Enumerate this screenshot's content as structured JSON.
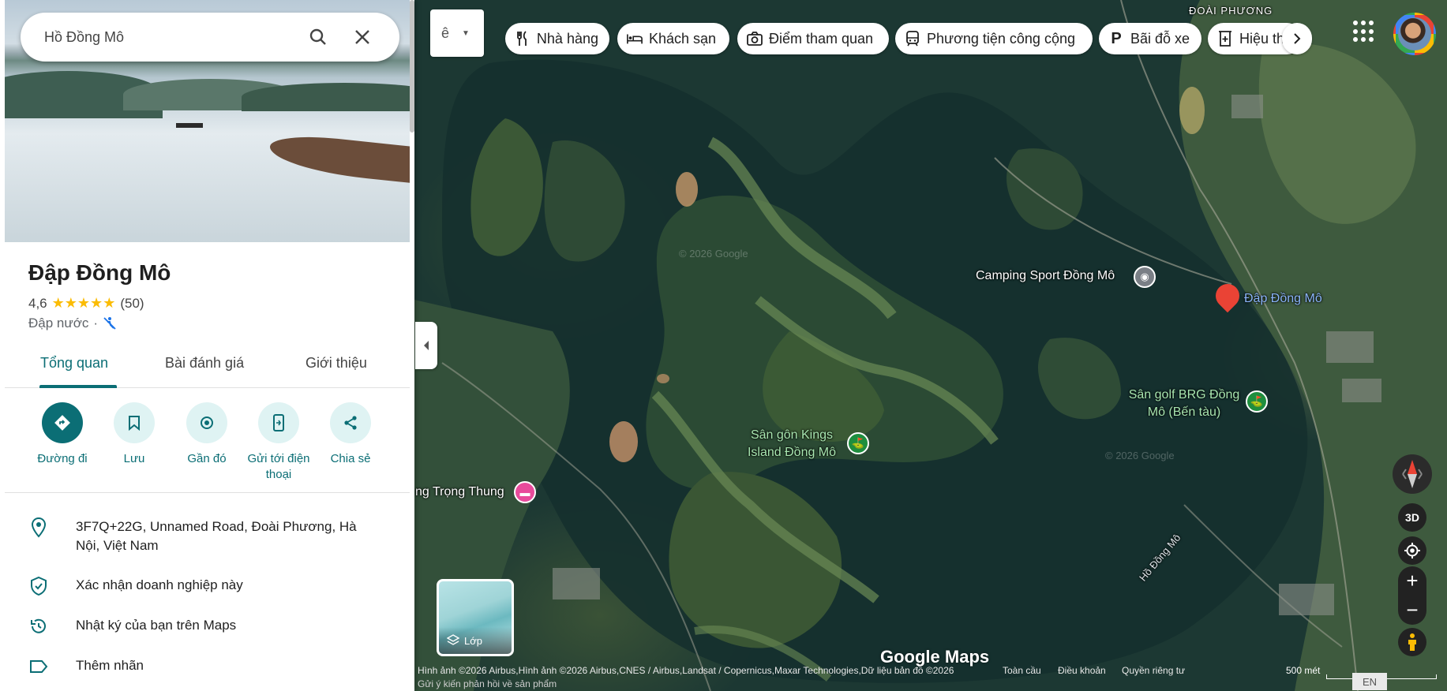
{
  "search": {
    "value": "Hồ Đồng Mô"
  },
  "place": {
    "title": "Đập Đồng Mô",
    "rating": "4,6",
    "stars": "★★★★★",
    "reviews": "(50)",
    "category": "Đập nước",
    "separator": "·"
  },
  "tabs": [
    {
      "label": "Tổng quan"
    },
    {
      "label": "Bài đánh giá"
    },
    {
      "label": "Giới thiệu"
    }
  ],
  "actions": [
    {
      "label": "Đường đi"
    },
    {
      "label": "Lưu"
    },
    {
      "label": "Gần đó"
    },
    {
      "label": "Gửi tới điện thoại"
    },
    {
      "label": "Chia sẻ"
    }
  ],
  "info": {
    "address": "3F7Q+22G, Unnamed Road, Đoài Phương, Hà Nội, Việt Nam",
    "claim": "Xác nhận doanh nghiệp này",
    "timeline": "Nhật ký của bạn trên Maps",
    "label": "Thêm nhãn"
  },
  "chips": [
    {
      "label": "Nhà hàng",
      "icon": "restaurant-icon"
    },
    {
      "label": "Khách sạn",
      "icon": "hotel-icon"
    },
    {
      "label": "Điểm tham quan",
      "icon": "camera-icon"
    },
    {
      "label": "Phương tiện công cộng",
      "icon": "transit-icon"
    },
    {
      "label": "Bãi đỗ xe",
      "icon": "parking-icon"
    },
    {
      "label": "Hiệu th",
      "icon": "pharmacy-icon"
    }
  ],
  "map_labels": {
    "area": "ĐOÀI PHƯƠNG",
    "camping": "Camping Sport Đồng Mô",
    "dam": "Đập Đồng Mô",
    "golf_brg": "Sân golf BRG Đồng Mô (Bến tàu)",
    "golf_kings": "Sân gôn Kings Island Đồng Mô",
    "trong_thung": "ng Trọng Thung",
    "lake": "Hồ Đồng Mô",
    "watermark": "© 2026 Google"
  },
  "controls": {
    "layers": "Lớp",
    "three_d": "3D",
    "zoom_in": "+",
    "zoom_out": "−"
  },
  "footer": {
    "attribution": "Hình ảnh ©2026 Airbus,Hình ảnh ©2026 Airbus,CNES / Airbus,Landsat / Copernicus,Maxar Technologies,Dữ liệu bản đồ ©2026",
    "global": "Toàn cầu",
    "terms": "Điều khoản",
    "privacy": "Quyền riêng tư",
    "feedback": "Gửi ý kiến phản hồi về sản phẩm",
    "scale": "500 mét",
    "lang": "EN",
    "logo": "Google Maps"
  },
  "colors": {
    "accent": "#0b6e75",
    "star": "#fbbc04",
    "pin_red": "#ea4335",
    "golf_green": "#1e8e3e",
    "hotel_pink": "#e84a9b"
  }
}
